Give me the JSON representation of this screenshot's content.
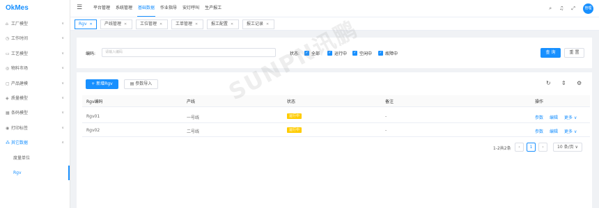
{
  "app": {
    "logo": "OkMes"
  },
  "header": {
    "nav": [
      "平台管理",
      "系统管理",
      "基础数据",
      "作业指导",
      "安灯呼叫",
      "生产报工"
    ],
    "avatar_text": "管理"
  },
  "sidebar": {
    "items": [
      {
        "icon": "factory-icon",
        "glyph": "⌂",
        "label": "工厂模型"
      },
      {
        "icon": "clock-icon",
        "glyph": "◷",
        "label": "工作时间"
      },
      {
        "icon": "process-icon",
        "glyph": "▭",
        "label": "工艺模型"
      },
      {
        "icon": "materials-icon",
        "glyph": "◎",
        "label": "物料市场"
      },
      {
        "icon": "product-icon",
        "glyph": "▢",
        "label": "产品建模"
      },
      {
        "icon": "quality-icon",
        "glyph": "◈",
        "label": "质量模型"
      },
      {
        "icon": "barcode-icon",
        "glyph": "▦",
        "label": "条码模型"
      },
      {
        "icon": "print-icon",
        "glyph": "◉",
        "label": "打印标签"
      },
      {
        "icon": "other-data-icon",
        "glyph": "⁂",
        "label": "其它数据"
      }
    ],
    "sub_items": [
      "度量单位",
      "Rgv"
    ]
  },
  "tabs": [
    "Rgv",
    "产线管理",
    "工位管理",
    "工单管理",
    "报工配置",
    "报工记录"
  ],
  "search": {
    "code_label": "编码:",
    "code_placeholder": "请输入编码",
    "status_label": "状态:",
    "statuses": [
      "全部",
      "运行中",
      "空闲中",
      "故障中"
    ],
    "query_button": "查 询",
    "reset_button": "重 置"
  },
  "toolbar": {
    "add_button": "新增Rgv",
    "import_button": "参数导入"
  },
  "table": {
    "headers": [
      "Rgv编码",
      "产线",
      "状态",
      "备注",
      "操作"
    ],
    "rows": [
      {
        "code": "Rgv01",
        "line": "一号线",
        "status": "运行中",
        "remark": "-"
      },
      {
        "code": "Rgv02",
        "line": "二号线",
        "status": "运行中",
        "remark": "-"
      }
    ],
    "actions": {
      "params": "参数",
      "edit": "编辑",
      "more": "更多"
    }
  },
  "pagination": {
    "summary": "1-2共2条",
    "current": "1",
    "page_size": "10 条/页"
  },
  "watermark": "SUNPN讯鹏",
  "colors": {
    "primary": "#1890ff",
    "status_badge": "#ffcc00"
  }
}
